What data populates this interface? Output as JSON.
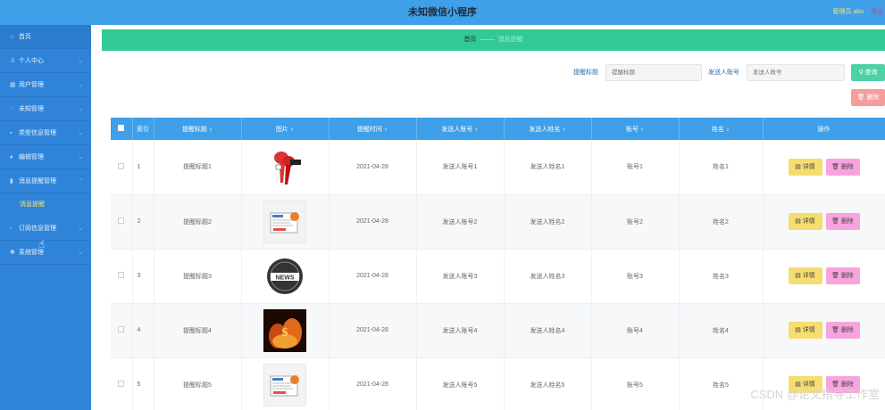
{
  "header": {
    "title": "未知微信小程序",
    "admin": "管理员 abo",
    "logout": "退出"
  },
  "sidebar": {
    "items": [
      {
        "label": "首页",
        "icon": "home-icon"
      },
      {
        "label": "个人中心",
        "icon": "user-icon"
      },
      {
        "label": "用户管理",
        "icon": "users-icon"
      },
      {
        "label": "未知管理",
        "icon": "power-icon"
      },
      {
        "label": "类型信息管理",
        "icon": "grid-icon"
      },
      {
        "label": "编辑管理",
        "icon": "pin-icon"
      },
      {
        "label": "消息提醒管理",
        "icon": "bar-chart-icon"
      }
    ],
    "sub_item": "消息提醒",
    "items_after": [
      {
        "label": "订阅信息管理",
        "icon": "doc-icon"
      },
      {
        "label": "系统管理",
        "icon": "gear-icon"
      }
    ]
  },
  "breadcrumb": {
    "home": "首页",
    "current": "消息提醒"
  },
  "search": {
    "label1": "提醒标题",
    "placeholder1": "提醒标题",
    "label2": "发送人账号",
    "placeholder2": "发送人账号",
    "search_btn": "查询",
    "delete_btn": "删除"
  },
  "table": {
    "headers": [
      "索引",
      "提醒标题",
      "图片",
      "提醒时间",
      "发送人账号",
      "发送人姓名",
      "账号",
      "姓名",
      "操作"
    ],
    "detail_label": "详情",
    "delete_label": "删除",
    "rows": [
      {
        "index": "1",
        "title": "提醒标题1",
        "image": "microphones",
        "time": "2021-04-28",
        "sender_account": "发送人账号1",
        "sender_name": "发送人姓名1",
        "account": "账号1",
        "name": "姓名1"
      },
      {
        "index": "2",
        "title": "提醒标题2",
        "image": "newspaper",
        "time": "2021-04-28",
        "sender_account": "发送人账号2",
        "sender_name": "发送人姓名2",
        "account": "账号2",
        "name": "姓名2"
      },
      {
        "index": "3",
        "title": "提醒标题3",
        "image": "news-badge",
        "time": "2021-04-28",
        "sender_account": "发送人账号3",
        "sender_name": "发送人姓名3",
        "account": "账号3",
        "name": "姓名3"
      },
      {
        "index": "4",
        "title": "提醒标题4",
        "image": "fire-dollar",
        "time": "2021-04-28",
        "sender_account": "发送人账号4",
        "sender_name": "发送人姓名4",
        "account": "账号4",
        "name": "姓名4"
      },
      {
        "index": "5",
        "title": "提醒标题5",
        "image": "newspaper",
        "time": "2021-04-28",
        "sender_account": "发送人账号5",
        "sender_name": "发送人姓名5",
        "account": "账号5",
        "name": "姓名5"
      }
    ]
  },
  "watermark": "CSDN @论文指导工作室",
  "colors": {
    "topbar": "#3f9fe8",
    "sidebar": "#2f84d9",
    "breadcrumb": "#33c997",
    "detail": "#f5dd6f",
    "delete": "#f7a4de"
  }
}
